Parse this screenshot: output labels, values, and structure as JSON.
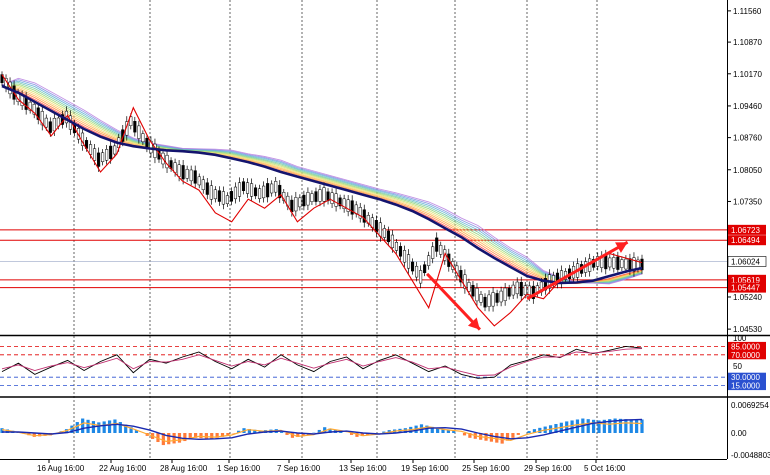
{
  "chart_data": [
    {
      "type": "line",
      "title": "",
      "description_panel": "main",
      "x": [
        "16 Aug 16:00",
        "22 Aug 16:00",
        "28 Aug 16:00",
        "1 Sep 16:00",
        "7 Sep 16:00",
        "13 Sep 16:00",
        "19 Sep 16:00",
        "25 Sep 16:00",
        "29 Sep 16:00",
        "5 Oct 16:00"
      ],
      "ylim": [
        1.044,
        1.118
      ],
      "y_ticks": [
        "1.11560",
        "1.10870",
        "1.10170",
        "1.09460",
        "1.08760",
        "1.08050",
        "1.07350",
        "1.05240",
        "1.04530"
      ],
      "hlines": [
        {
          "label": "1.06723",
          "value": 1.06723,
          "color": "#e00000"
        },
        {
          "label": "1.06494",
          "value": 1.06494,
          "color": "#e00000"
        },
        {
          "label": "1.05619",
          "value": 1.05619,
          "color": "#e00000"
        },
        {
          "label": "1.05447",
          "value": 1.05447,
          "color": "#e00000"
        }
      ],
      "current_price": {
        "label": "1.06024",
        "value": 1.06024
      },
      "series": [
        {
          "values": [
            1.099,
            1.0975,
            1.0955,
            1.0935,
            1.0915,
            1.0895,
            1.0878,
            1.0865,
            1.0857,
            1.0852,
            1.0848,
            1.0846,
            1.0843,
            1.0838,
            1.083,
            1.0822,
            1.0812,
            1.08,
            1.079,
            1.078,
            1.077,
            1.076,
            1.075,
            1.074,
            1.0728,
            1.0714,
            1.0696,
            1.0676,
            1.0656,
            1.0632,
            1.061,
            1.059,
            1.057,
            1.056,
            1.0555,
            1.0556,
            1.056,
            1.057,
            1.058,
            1.0588
          ]
        },
        {
          "values": [
            1.1015,
            1.096,
            1.093,
            1.088,
            1.0925,
            1.086,
            1.08,
            1.084,
            1.0942,
            1.087,
            1.082,
            1.078,
            1.076,
            1.071,
            1.069,
            1.074,
            1.072,
            1.075,
            1.069,
            1.072,
            1.074,
            1.072,
            1.07,
            1.066,
            1.062,
            1.056,
            1.05,
            1.062,
            1.056,
            1.05,
            1.046,
            1.049,
            1.053,
            1.052,
            1.056,
            1.058,
            1.06,
            1.062,
            1.061,
            1.06
          ]
        }
      ]
    },
    {
      "type": "line",
      "description_panel": "oscillator",
      "ylim": [
        0,
        100
      ],
      "y_ticks": [
        "100",
        "50"
      ],
      "hlines": [
        {
          "label": "85.0000",
          "value": 85,
          "color": "#e00000"
        },
        {
          "label": "70.0000",
          "value": 70,
          "color": "#e00000"
        },
        {
          "label": "30.0000",
          "value": 30,
          "color": "#2a50d0"
        },
        {
          "label": "15.0000",
          "value": 15,
          "color": "#2a50d0"
        }
      ],
      "series": [
        {
          "values": [
            40,
            55,
            35,
            48,
            60,
            42,
            58,
            70,
            38,
            62,
            55,
            66,
            75,
            58,
            45,
            62,
            48,
            70,
            52,
            40,
            58,
            66,
            45,
            60,
            70,
            55,
            40,
            50,
            35,
            28,
            30,
            52,
            60,
            70,
            65,
            80,
            72,
            78,
            85,
            82
          ]
        },
        {
          "values": [
            45,
            52,
            42,
            50,
            56,
            47,
            55,
            64,
            45,
            58,
            57,
            62,
            70,
            60,
            50,
            58,
            52,
            64,
            55,
            46,
            55,
            62,
            50,
            58,
            65,
            57,
            45,
            48,
            40,
            33,
            34,
            48,
            58,
            66,
            66,
            75,
            73,
            76,
            80,
            81
          ]
        }
      ]
    },
    {
      "type": "bar",
      "description_panel": "histogram",
      "ylim": [
        -0.0048803,
        0.0069254
      ],
      "y_ticks": [
        "0.0069254",
        "0.00",
        "-0.0048803"
      ],
      "series": [
        {
          "values": [
            0.001,
            0.0002,
            -0.0008,
            -0.0005,
            0.0008,
            0.003,
            0.0022,
            0.0028,
            0.0012,
            -0.0006,
            -0.0025,
            -0.002,
            -0.001,
            -0.0012,
            -0.0006,
            0.001,
            0.0005,
            0.0008,
            -0.001,
            -0.0005,
            0.0012,
            0.0004,
            -0.0008,
            -0.0003,
            0.0006,
            0.001,
            0.0018,
            0.001,
            0.0005,
            -0.001,
            -0.0016,
            -0.0022,
            -0.0004,
            0.0008,
            0.0016,
            0.0024,
            0.003,
            0.0026,
            0.003,
            0.0028
          ]
        },
        {
          "values": [
            0.0002,
            0.0002,
            0.0,
            -0.0002,
            0.0001,
            0.001,
            0.0015,
            0.0018,
            0.0014,
            0.0006,
            -0.0005,
            -0.0011,
            -0.0013,
            -0.0012,
            -0.001,
            -0.0002,
            0.0002,
            0.0004,
            0.0,
            -0.0002,
            0.0002,
            0.0004,
            0.0,
            -0.0002,
            0.0,
            0.0004,
            0.001,
            0.0011,
            0.0008,
            0.0,
            -0.0007,
            -0.0012,
            -0.001,
            -0.0004,
            0.0004,
            0.0012,
            0.002,
            0.0024,
            0.0027,
            0.0028
          ]
        }
      ]
    }
  ],
  "colors": {
    "background": "#ffffff",
    "grid": "#000000",
    "level_red": "#e00000",
    "level_blue": "#2a50d0",
    "ma_navy": "#14146e",
    "arrow": "#ff2020",
    "candle": "#000000",
    "hist_up": "#1e88e5",
    "hist_down": "#ff7b3a"
  }
}
